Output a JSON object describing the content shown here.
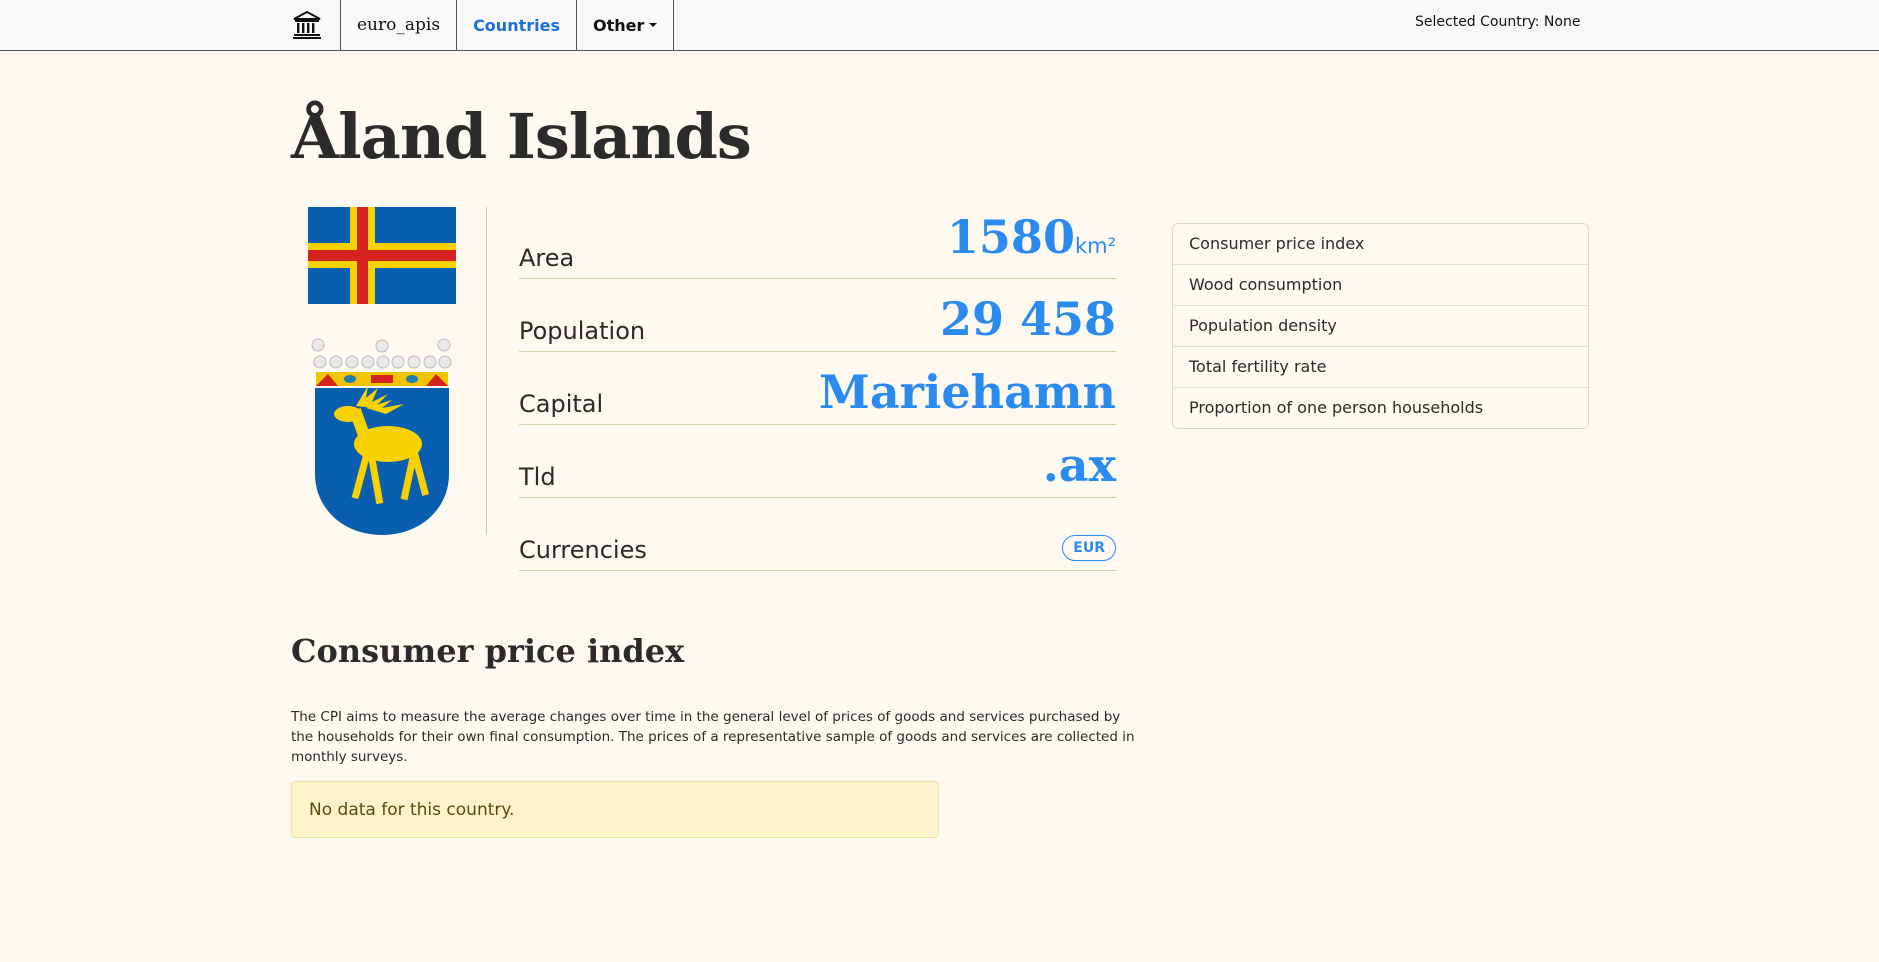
{
  "nav": {
    "logo_icon": "museum-icon",
    "brand": "euro_apis",
    "countries": "Countries",
    "other": "Other",
    "selected_country": "Selected Country: None"
  },
  "country": {
    "name": "Åland Islands",
    "facts": [
      {
        "label": "Area",
        "value": "1580",
        "unit": "km²"
      },
      {
        "label": "Population",
        "value": "29 458"
      },
      {
        "label": "Capital",
        "value": "Mariehamn"
      },
      {
        "label": "Tld",
        "value": ".ax"
      },
      {
        "label": "Currencies",
        "badge": "EUR"
      }
    ]
  },
  "side_menu": {
    "items": [
      "Consumer price index",
      "Wood consumption",
      "Population density",
      "Total fertility rate",
      "Proportion of one person households"
    ]
  },
  "section": {
    "title": "Consumer price index",
    "description": "The CPI aims to measure the average changes over time in the general level of prices of goods and services purchased by the households for their own final consumption. The prices of a representative sample of goods and services are collected in monthly surveys.",
    "alert": "No data for this country."
  },
  "colors": {
    "accent": "#2a8aee",
    "background": "#fdf9f1",
    "alert_bg": "#fdf2c9"
  }
}
